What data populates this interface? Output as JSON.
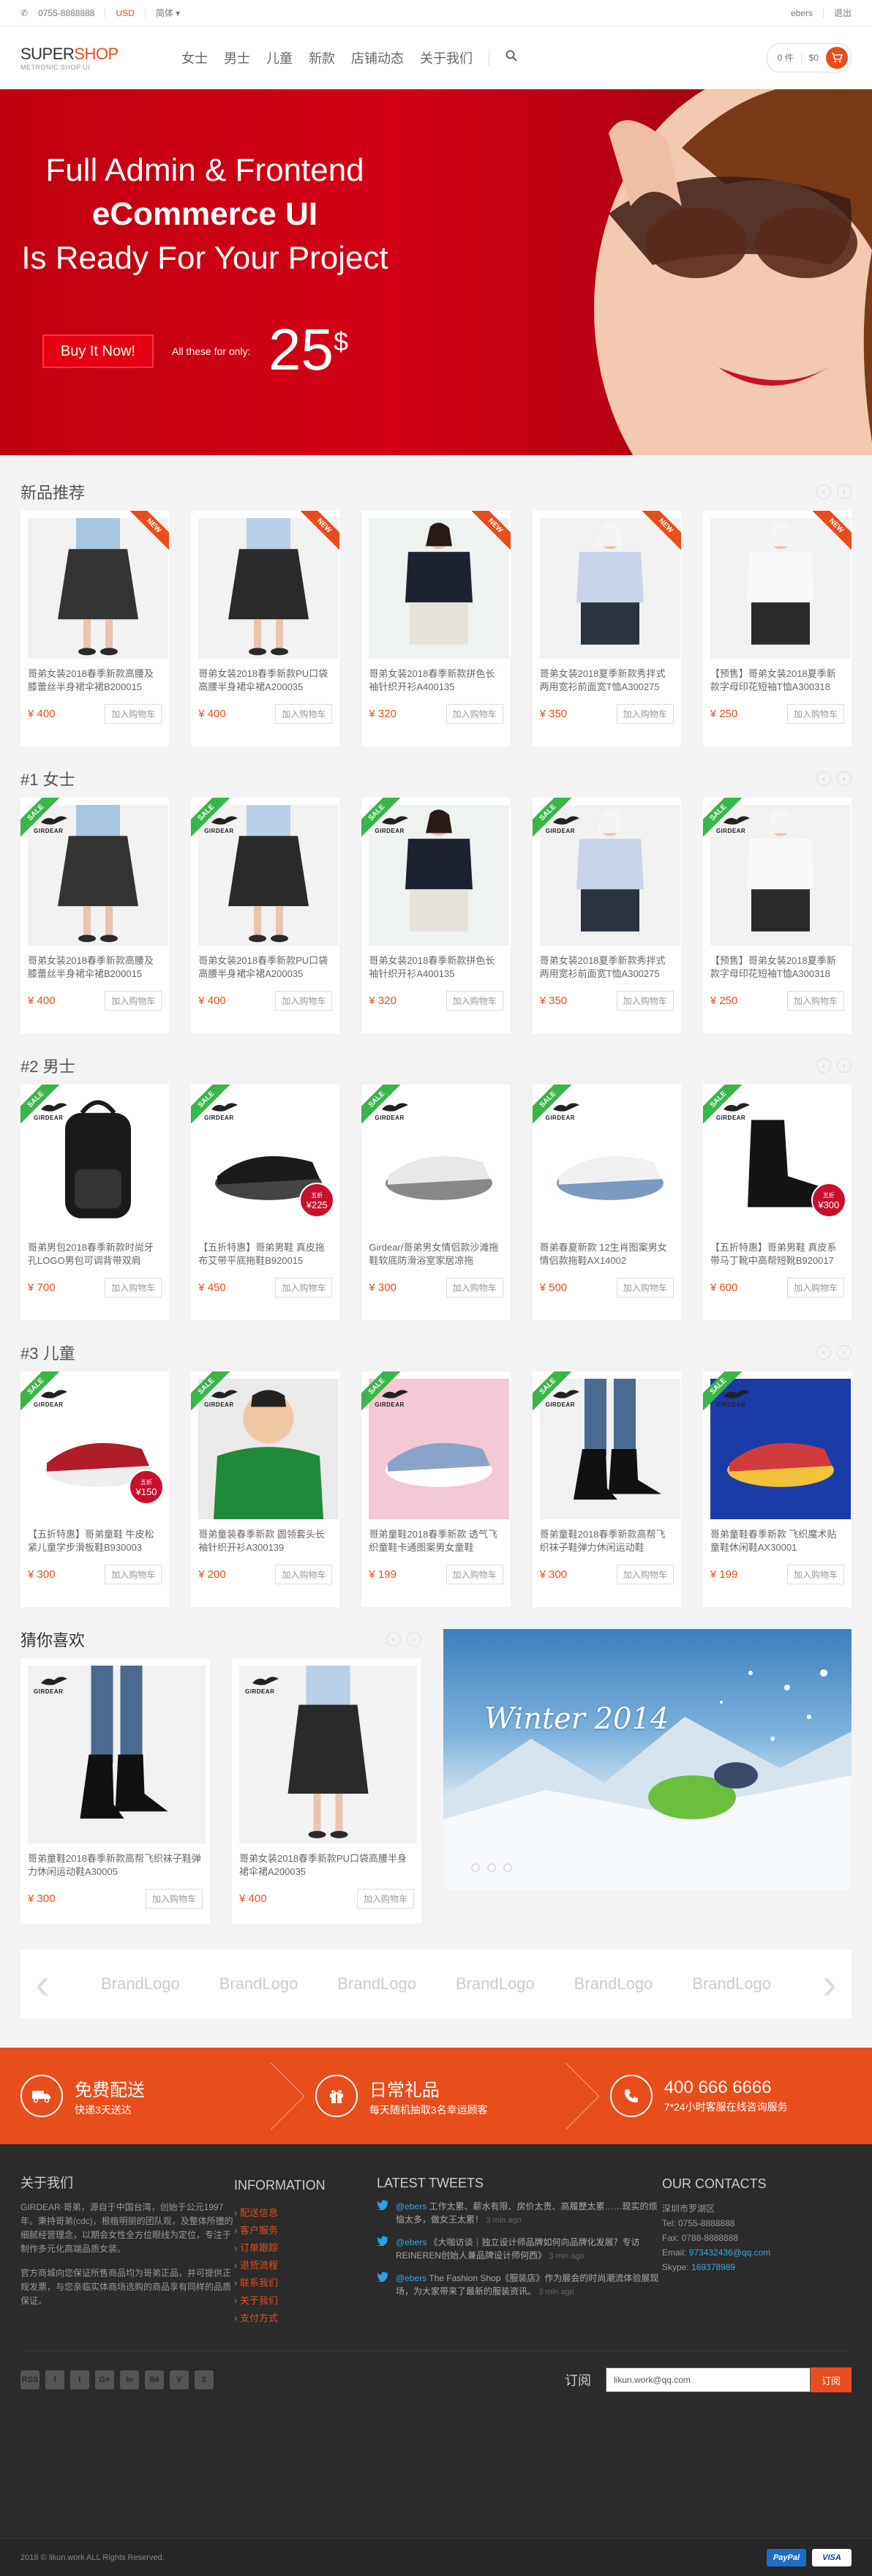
{
  "topbar": {
    "phone": "0755-8888888",
    "currency": "USD",
    "language": "简体",
    "user": "ebers",
    "logout": "退出"
  },
  "header": {
    "logo_main": "SUPER",
    "logo_accent": "SHOP",
    "logo_sub": "METRONIC SHOP UI",
    "nav": [
      "女士",
      "男士",
      "儿童",
      "新款",
      "店铺动态",
      "关于我们"
    ],
    "cart_count": "0 件",
    "cart_total": "$0"
  },
  "hero": {
    "line1": "Full Admin & Frontend",
    "line2": "eCommerce UI",
    "line3": "Is Ready For Your Project",
    "button": "Buy It Now!",
    "for_only": "All these for only:",
    "price": "25",
    "currency": "$"
  },
  "sections": [
    {
      "title": "新品推荐",
      "prefix": "",
      "ribbon": "NEW",
      "products": [
        {
          "title": "哥弟女装2018春季新款高腰及膝蕾丝半身裙伞裙B200015",
          "price": "¥ 400",
          "add": "加入购物车",
          "img": "skirt-lace"
        },
        {
          "title": "哥弟女装2018春季新款PU口袋高腰半身裙伞裙A200035",
          "price": "¥ 400",
          "add": "加入购物车",
          "img": "skirt-leather"
        },
        {
          "title": "哥弟女装2018春季新款拼色长袖针织开衫A400135",
          "price": "¥ 320",
          "add": "加入购物车",
          "img": "cardigan"
        },
        {
          "title": "哥弟女装2018夏季新款秀拌式两用宽衫前面宽T恤A300275",
          "price": "¥ 350",
          "add": "加入购物车",
          "img": "blouse"
        },
        {
          "title": "【预售】哥弟女装2018夏季新款字母印花短袖T恤A300318",
          "price": "¥ 250",
          "add": "加入购物车",
          "img": "tshirt"
        }
      ]
    },
    {
      "title": "女士",
      "prefix": "#1 ",
      "ribbon": "SALE",
      "products": [
        {
          "title": "哥弟女装2018春季新款高腰及膝蕾丝半身裙伞裙B200015",
          "price": "¥ 400",
          "add": "加入购物车",
          "img": "skirt-lace"
        },
        {
          "title": "哥弟女装2018春季新款PU口袋高腰半身裙伞裙A200035",
          "price": "¥ 400",
          "add": "加入购物车",
          "img": "skirt-leather"
        },
        {
          "title": "哥弟女装2018春季新款拼色长袖针织开衫A400135",
          "price": "¥ 320",
          "add": "加入购物车",
          "img": "cardigan"
        },
        {
          "title": "哥弟女装2018夏季新款秀拌式两用宽衫前面宽T恤A300275",
          "price": "¥ 350",
          "add": "加入购物车",
          "img": "blouse"
        },
        {
          "title": "【预售】哥弟女装2018夏季新款字母印花短袖T恤A300318",
          "price": "¥ 250",
          "add": "加入购物车",
          "img": "tshirt"
        }
      ]
    },
    {
      "title": "男士",
      "prefix": "#2 ",
      "ribbon": "SALE",
      "products": [
        {
          "title": "哥弟男包2018春季新款时尚牙孔LOGO男包可调背带双肩",
          "price": "¥ 700",
          "add": "加入购物车",
          "img": "backpack"
        },
        {
          "title": "【五折特惠】哥弟男鞋 真皮拖布艾带平底拖鞋B920015",
          "price": "¥ 450",
          "add": "加入购物车",
          "img": "slide-black",
          "badge": "225",
          "badge_lbl": "五折"
        },
        {
          "title": "Girdear/哥弟男女情侣款沙滩拖鞋软底防滑浴室家居凉拖",
          "price": "¥ 300",
          "add": "加入购物车",
          "img": "slide-white"
        },
        {
          "title": "哥弟春夏新款 12生肖图案男女情侣款拖鞋AX14002",
          "price": "¥ 500",
          "add": "加入购物车",
          "img": "slide-print"
        },
        {
          "title": "【五折特惠】哥弟男鞋 真皮系带马丁靴中高帮短靴B920017",
          "price": "¥ 600",
          "add": "加入购物车",
          "img": "boot",
          "badge": "300",
          "badge_lbl": "五折"
        }
      ]
    },
    {
      "title": "儿童",
      "prefix": "#3 ",
      "ribbon": "SALE",
      "products": [
        {
          "title": "【五折特惠】哥弟童鞋 牛皮松紧儿童学步滑板鞋B930003",
          "price": "¥ 300",
          "add": "加入购物车",
          "img": "kid-loafer",
          "badge": "150",
          "badge_lbl": "五折"
        },
        {
          "title": "哥弟童装春季新款 圆领套头长袖针织开衫A300139",
          "price": "¥ 200",
          "add": "加入购物车",
          "img": "kid-sweater"
        },
        {
          "title": "哥弟童鞋2018春季新款 透气飞织童鞋卡通图案男女童鞋",
          "price": "¥ 199",
          "add": "加入购物车",
          "img": "kid-sneaker"
        },
        {
          "title": "哥弟童鞋2018春季新款高帮飞织袜子鞋弹力休闲运动鞋",
          "price": "¥ 300",
          "add": "加入购物车",
          "img": "kid-sock"
        },
        {
          "title": "哥弟童鞋春季新款 飞织魔术贴 童鞋休闲鞋AX30001",
          "price": "¥ 199",
          "add": "加入购物车",
          "img": "kid-runner"
        }
      ]
    }
  ],
  "guess": {
    "title": "猜你喜欢",
    "products": [
      {
        "title": "哥弟童鞋2018春季新款高帮飞织袜子鞋弹力休闲运动鞋A30005",
        "price": "¥ 300",
        "add": "加入购物车",
        "img": "kid-sock"
      },
      {
        "title": "哥弟女装2018春季新款PU口袋高腰半身裙伞裙A200035",
        "price": "¥ 400",
        "add": "加入购物车",
        "img": "skirt-leather"
      }
    ],
    "banner_title": "Winter 2014"
  },
  "brands": {
    "items": [
      "BrandLogo",
      "BrandLogo",
      "BrandLogo",
      "BrandLogo",
      "BrandLogo",
      "BrandLogo"
    ]
  },
  "features": [
    {
      "title": "免费配送",
      "sub": "快递3天送达",
      "icon": "truck-icon"
    },
    {
      "title": "日常礼品",
      "sub": "每天随机抽取3名幸运顾客",
      "icon": "gift-icon"
    },
    {
      "title": "400 666 6666",
      "sub": "7*24小时客服在线咨询服务",
      "icon": "phone-icon"
    }
  ],
  "footer": {
    "about_title": "关于我们",
    "about_p1": "GIRDEAR·哥弟，源自于中国台湾，创始于公元1997年。秉持哥弟(cdc)，根植明丽的团队观，及整体所擅的细腻经营理念，以期会女性全方位眼线为定位，专注于制作多元化高端品质女装。",
    "about_p2": "官方商城向您保证所售商品均为哥弟正品，并可提供正规发票，与您亲临实体商场选购的商品享有同样的品质保证。",
    "info_title": "INFORMATION",
    "info_links": [
      "配送信息",
      "客户服务",
      "订单跟踪",
      "退货流程",
      "联系我们",
      "关于我们",
      "支付方式"
    ],
    "tweets_title": "LATEST TWEETS",
    "tweets": [
      {
        "handle": "@ebers",
        "text": " 工作太累、薪水有限、房价太贵、高履歷太累……现实的烦恼太多，做女王太累！",
        "time": "3 min ago"
      },
      {
        "handle": "@ebers",
        "text": " 《大咖访谈｜独立设计师品牌如何向品牌化发展？专访REINEREN创始人兼品牌设计师何西》",
        "time": "3 min ago"
      },
      {
        "handle": "@ebers",
        "text": " The Fashion Shop《服装店》作为展会的时尚潮流体验展现场，为大家带来了最新的服装资讯。",
        "time": "3 min ago"
      }
    ],
    "contacts_title": "OUR CONTACTS",
    "address": "深圳市罗湖区",
    "tel": "Tel: 0755-8888888",
    "fax": "Fax: 0788-8888888",
    "email_label": "Email: ",
    "email": "973432436@qq.com",
    "skype_label": "Skype: ",
    "skype": "169378989",
    "social": [
      "RSS",
      "f",
      "t",
      "G+",
      "in",
      "Bē",
      "V",
      "S"
    ],
    "subscribe_label": "订阅",
    "subscribe_value": "likun.work@qq.com",
    "subscribe_button": "订阅",
    "copyright": "2018 © likun.work ALL Rights Reserved.",
    "pay": [
      "PayPal",
      "VISA"
    ]
  },
  "colors": {
    "accent": "#e84d1c",
    "sale": "#3ab54a",
    "hero_red": "#c00010",
    "footer_bg": "#2b2b2b"
  }
}
